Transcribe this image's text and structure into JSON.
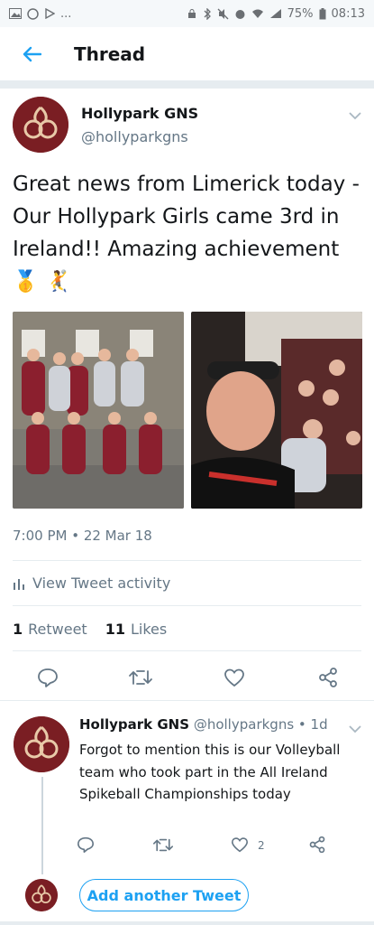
{
  "status_bar": {
    "battery": "75%",
    "time": "08:13",
    "more": "..."
  },
  "header": {
    "title": "Thread",
    "back_icon": "arrow-left-icon"
  },
  "tweet": {
    "author_name": "Hollypark GNS",
    "author_handle": "@hollyparkgns",
    "text": "Great news from Limerick today - Our Hollypark Girls came 3rd in Ireland!! Amazing achievement 🥇 🤾",
    "timestamp": "7:00 PM • 22 Mar 18",
    "activity_label": "View Tweet activity",
    "retweet_count": "1",
    "retweet_label": "Retweet",
    "likes_count": "11",
    "likes_label": "Likes"
  },
  "reply": {
    "author_name": "Hollypark GNS",
    "author_handle": "@hollyparkgns",
    "time": "• 1d",
    "text": "Forgot to mention this is our Volleyball team who took part in the All Ireland Spikeball Championships today",
    "like_count": "2"
  },
  "compose": {
    "add_label": "Add another Tweet"
  },
  "colors": {
    "accent": "#1da1f2",
    "avatar_bg": "#7a1e23",
    "secondary_text": "#657786"
  }
}
